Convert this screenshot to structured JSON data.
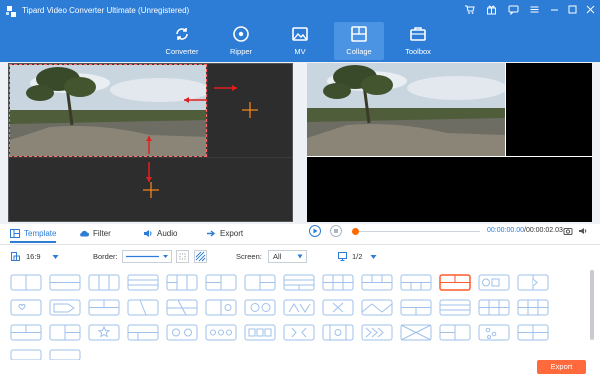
{
  "app": {
    "title": "Tipard Video Converter Ultimate (Unregistered)"
  },
  "nav": {
    "tabs": [
      {
        "label": "Converter",
        "icon": "refresh-icon"
      },
      {
        "label": "Ripper",
        "icon": "disc-icon"
      },
      {
        "label": "MV",
        "icon": "image-icon"
      },
      {
        "label": "Collage",
        "icon": "collage-icon",
        "active": true
      },
      {
        "label": "Toolbox",
        "icon": "toolbox-icon"
      }
    ]
  },
  "window_controls": [
    "cart-icon",
    "gift-icon",
    "chat-icon",
    "menu-icon",
    "minimize-icon",
    "maximize-icon",
    "close-icon"
  ],
  "player": {
    "time_current": "00:00:00.00",
    "time_separator": "/",
    "time_total": "00:00:02.03"
  },
  "tabs": [
    {
      "label": "Template",
      "icon": "template-icon",
      "active": true
    },
    {
      "label": "Filter",
      "icon": "cloud-icon"
    },
    {
      "label": "Audio",
      "icon": "speaker-icon"
    },
    {
      "label": "Export",
      "icon": "export-arrow-icon"
    }
  ],
  "options": {
    "aspect": "16:9",
    "border_label": "Border:",
    "screen_label": "Screen:",
    "screen_value": "All",
    "page": "1/2"
  },
  "export_label": "Export",
  "colors": {
    "brand": "#2d7cd6",
    "accent": "#ff6a00",
    "export_button": "#ff6a3d"
  }
}
